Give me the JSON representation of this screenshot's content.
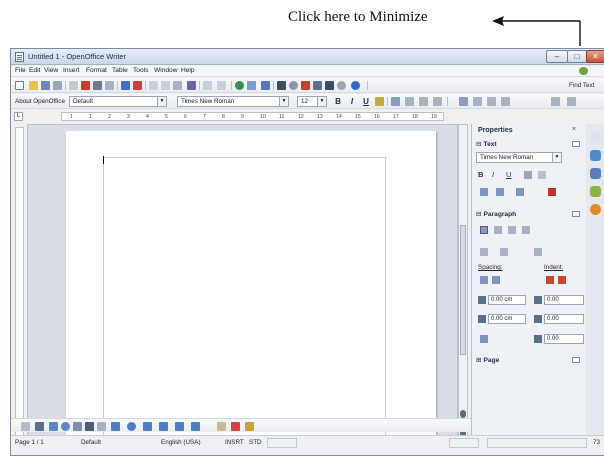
{
  "annotation": {
    "text": "Click here to Minimize"
  },
  "window": {
    "title": "Untitled 1 - OpenOffice Writer",
    "controls": {
      "minimize": "–",
      "maximize": "□",
      "close": "✕"
    }
  },
  "menu": [
    "File",
    "Edit",
    "View",
    "Insert",
    "Format",
    "Table",
    "Tools",
    "Window",
    "Help"
  ],
  "standard_toolbar": {
    "icons": [
      "new-doc-icon",
      "open-icon",
      "save-icon",
      "email-icon",
      "edit-file-icon",
      "pdf-icon",
      "print-icon",
      "print-preview-icon",
      "spellcheck-icon",
      "autospell-icon",
      "cut-icon",
      "copy-icon",
      "paste-icon",
      "clone-icon",
      "undo-icon",
      "redo-icon",
      "hyperlink-icon",
      "table-icon",
      "show-draw-icon",
      "find-icon",
      "navigator-icon",
      "gallery-icon",
      "data-sources-icon",
      "nonprinting-icon",
      "zoom-icon",
      "help-icon"
    ],
    "find_label": "Find Text"
  },
  "format_toolbar": {
    "style_label": "About OpenOffice",
    "paragraph_style": "Default",
    "font_name": "Times New Roman",
    "font_size": "12",
    "bold": "B",
    "italic": "I",
    "underline": "U"
  },
  "ruler": {
    "corner": "L",
    "numbers": [
      "1",
      "1",
      "2",
      "3",
      "4",
      "5",
      "6",
      "7",
      "8",
      "9",
      "10",
      "11",
      "12",
      "13",
      "14",
      "15",
      "16",
      "17",
      "18",
      "19"
    ]
  },
  "sidebar": {
    "title": "Properties",
    "close": "×",
    "text_section": "Text",
    "font_name": "Times New Roman",
    "bold": "B",
    "italic": "I",
    "underline": "U",
    "paragraph_section": "Paragraph",
    "spacing_label": "Spacing:",
    "indent_label": "Indent:",
    "spacing_above": "0.00 cm",
    "spacing_below": "0.00 cm",
    "indent_before": "0.00",
    "indent_after": "0.00",
    "first_line": "0.00",
    "page_section": "Page"
  },
  "status": {
    "page": "Page 1 / 1",
    "style": "Default",
    "language": "English (USA)",
    "insert_mode": "INSRT",
    "selection_mode": "STD",
    "zoom": "73"
  },
  "colors": {
    "titlebar": "#c9d7ea",
    "close_button": "#c9533c",
    "toolbar": "#e9ecf0",
    "document_bg": "#d9dee6",
    "sidebar_bg": "#eef1f6"
  }
}
